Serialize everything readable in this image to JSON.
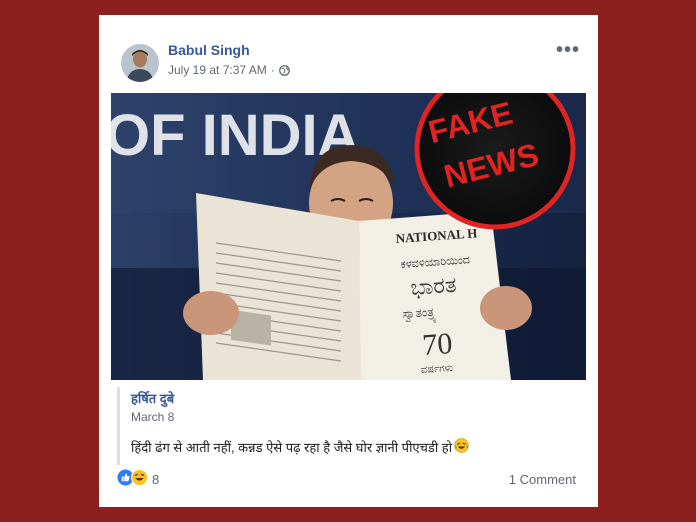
{
  "post": {
    "author": "Babul Singh",
    "timestamp": "July 19 at 7:37 AM",
    "privacy_icon": "globe-icon",
    "more_label": "•••"
  },
  "photo": {
    "backdrop_text": "OF INDIA",
    "newspaper_masthead": "NATIONAL H",
    "newspaper_headline_1": "ಕಳವಳಿಯಾರಿಯಿಂದ",
    "newspaper_headline_2": "ಭಾರತ",
    "newspaper_headline_3": "ಸ್ವಾತಂತ್ರ್ಯ",
    "newspaper_number": "70",
    "newspaper_line_4": "ವರ್ಷಗಳು",
    "stamp_line_1": "FAKE",
    "stamp_line_2": "NEWS"
  },
  "quote": {
    "author": "हर्षित दुबे",
    "date": "March 8",
    "text": "हिंदी ढंग से आती नहीं, कन्नड ऐसे पढ़ रहा है जैसे घोर ज्ञानी पीएचडी हो",
    "emoji_icon": "laughing-tears-emoji-icon"
  },
  "footer": {
    "reaction_count": "8",
    "comments_label": "1 Comment"
  },
  "colors": {
    "background": "#8e1f1f",
    "link_blue": "#385898",
    "stamp_red": "#e02424"
  }
}
